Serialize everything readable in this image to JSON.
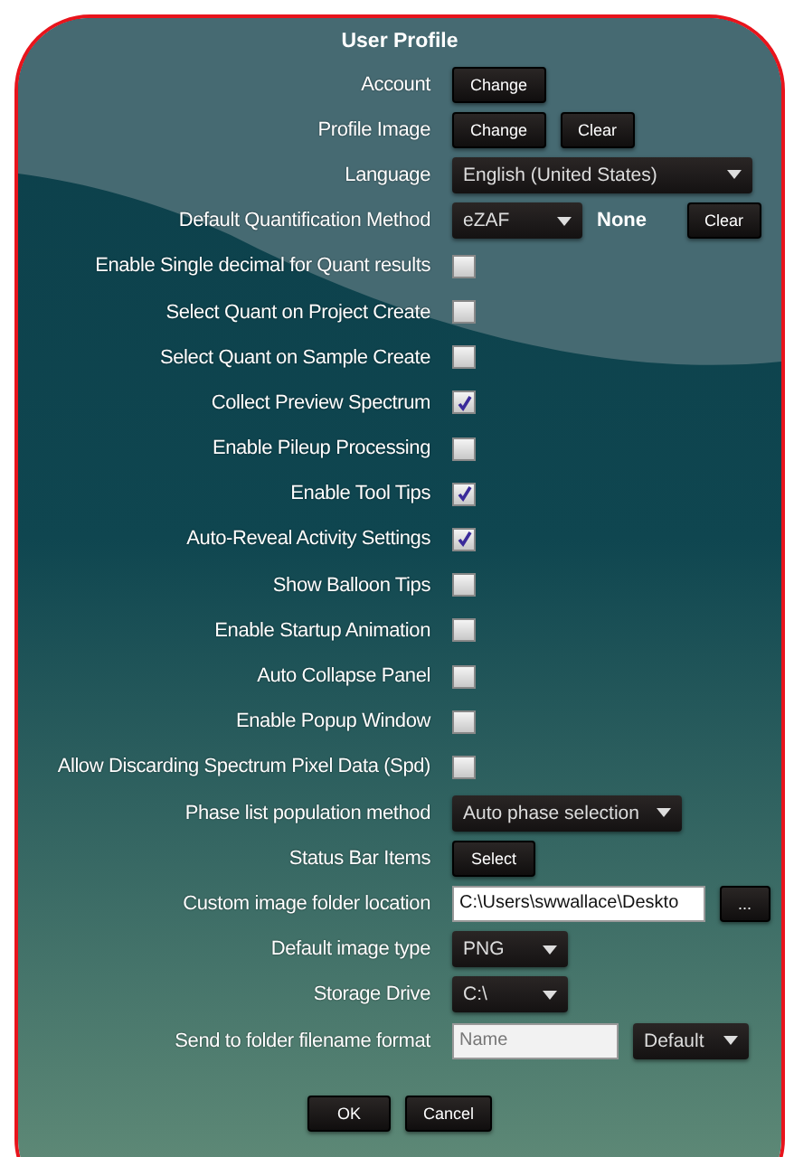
{
  "title": "User Profile",
  "rows": [
    {
      "label": "Account",
      "controls": [
        {
          "kind": "button",
          "text": "Change"
        }
      ]
    },
    {
      "label": "Profile Image",
      "controls": [
        {
          "kind": "button",
          "text": "Change"
        },
        {
          "kind": "button",
          "text": "Clear"
        }
      ]
    },
    {
      "label": "Language",
      "controls": [
        {
          "kind": "dropdown",
          "value": "English (United States)"
        }
      ]
    },
    {
      "label": "Default Quantification Method",
      "controls": [
        {
          "kind": "dropdown",
          "value": "eZAF"
        },
        {
          "kind": "text",
          "text": "None"
        },
        {
          "kind": "button",
          "text": "Clear"
        }
      ]
    },
    {
      "label": "Enable Single decimal for Quant results",
      "controls": [
        {
          "kind": "checkbox",
          "checked": false
        }
      ]
    },
    {
      "label": "Select Quant on Project Create",
      "controls": [
        {
          "kind": "checkbox",
          "checked": false
        }
      ]
    },
    {
      "label": "Select Quant on Sample Create",
      "controls": [
        {
          "kind": "checkbox",
          "checked": false
        }
      ]
    },
    {
      "label": "Collect Preview Spectrum",
      "controls": [
        {
          "kind": "checkbox",
          "checked": true
        }
      ]
    },
    {
      "label": "Enable Pileup Processing",
      "controls": [
        {
          "kind": "checkbox",
          "checked": false
        }
      ]
    },
    {
      "label": "Enable Tool Tips",
      "controls": [
        {
          "kind": "checkbox",
          "checked": true
        }
      ]
    },
    {
      "label": "Auto-Reveal Activity Settings",
      "controls": [
        {
          "kind": "checkbox",
          "checked": true
        }
      ]
    },
    {
      "label": "Show Balloon Tips",
      "controls": [
        {
          "kind": "checkbox",
          "checked": false
        }
      ]
    },
    {
      "label": "Enable Startup Animation",
      "controls": [
        {
          "kind": "checkbox",
          "checked": false
        }
      ]
    },
    {
      "label": "Auto Collapse Panel",
      "controls": [
        {
          "kind": "checkbox",
          "checked": false
        }
      ]
    },
    {
      "label": "Enable Popup Window",
      "controls": [
        {
          "kind": "checkbox",
          "checked": false
        }
      ]
    },
    {
      "label": "Allow Discarding Spectrum Pixel Data (Spd)",
      "controls": [
        {
          "kind": "checkbox",
          "checked": false
        }
      ]
    },
    {
      "label": "Phase list population method",
      "controls": [
        {
          "kind": "dropdown",
          "value": "Auto phase selection"
        }
      ]
    },
    {
      "label": "Status Bar Items",
      "controls": [
        {
          "kind": "button",
          "text": "Select"
        }
      ]
    },
    {
      "label": "Custom image folder location",
      "controls": [
        {
          "kind": "input",
          "value": "C:\\Users\\swwallace\\Deskto"
        },
        {
          "kind": "button",
          "text": "..."
        }
      ]
    },
    {
      "label": "Default image type",
      "controls": [
        {
          "kind": "dropdown",
          "value": "PNG"
        }
      ]
    },
    {
      "label": "Storage Drive",
      "controls": [
        {
          "kind": "dropdown",
          "value": "C:\\"
        }
      ]
    },
    {
      "label": "Send to folder filename format",
      "controls": [
        {
          "kind": "input",
          "placeholder": "Name"
        },
        {
          "kind": "dropdown",
          "value": "Default"
        }
      ]
    }
  ],
  "buttons": [
    "OK",
    "Cancel"
  ]
}
